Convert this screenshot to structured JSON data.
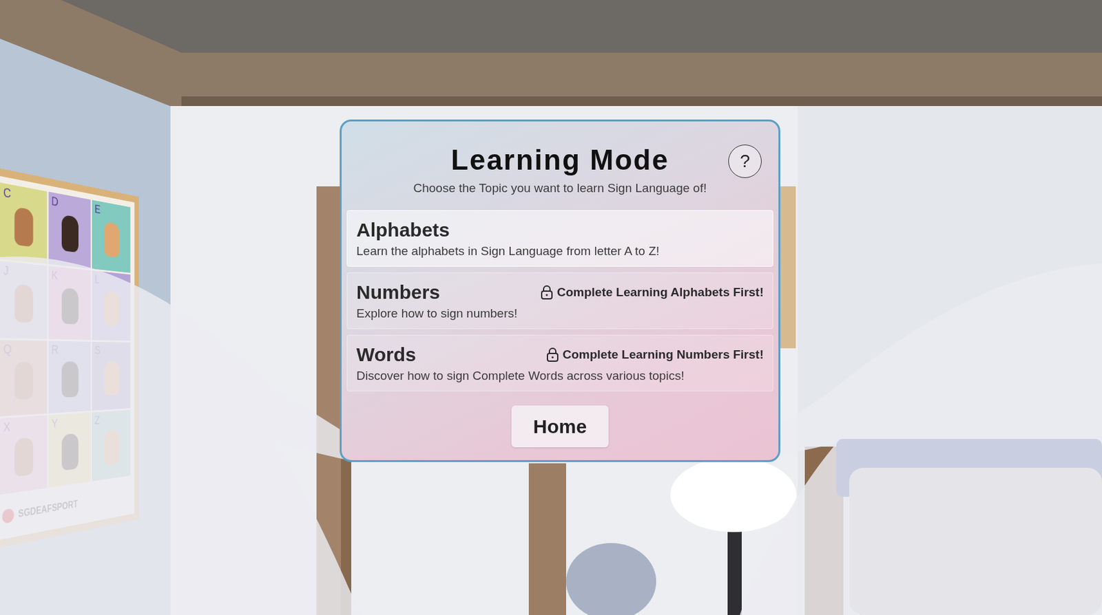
{
  "scene": {
    "poster": {
      "tiles": [
        {
          "letter": "C",
          "color": "#d9d98c"
        },
        {
          "letter": "D",
          "color": "#bba9d9"
        },
        {
          "letter": "E",
          "color": "#82c9c0"
        },
        {
          "letter": "J",
          "color": "#c9c2d9"
        },
        {
          "letter": "K",
          "color": "#e2a3c9"
        },
        {
          "letter": "L",
          "color": "#b3a3d6"
        },
        {
          "letter": "Q",
          "color": "#d9a392"
        },
        {
          "letter": "R",
          "color": "#b3aad9"
        },
        {
          "letter": "S",
          "color": "#a99ac9"
        },
        {
          "letter": "X",
          "color": "#e8b2c9"
        },
        {
          "letter": "Y",
          "color": "#e8d993"
        },
        {
          "letter": "Z",
          "color": "#9bc9c0"
        }
      ],
      "brand": "SGDEAFSPORT"
    }
  },
  "panel": {
    "title": "Learning Mode",
    "subtitle": "Choose the Topic you want to learn Sign Language of!",
    "help_button": "?",
    "topics": [
      {
        "title": "Alphabets",
        "description": "Learn the alphabets in Sign Language from letter A to Z!",
        "locked": false
      },
      {
        "title": "Numbers",
        "description": "Explore how to sign numbers!",
        "locked": true,
        "lock_message": "Complete Learning Alphabets First!"
      },
      {
        "title": "Words",
        "description": "Discover how to sign Complete Words across various topics!",
        "locked": true,
        "lock_message": "Complete Learning Numbers First!"
      }
    ],
    "home_button": "Home"
  }
}
